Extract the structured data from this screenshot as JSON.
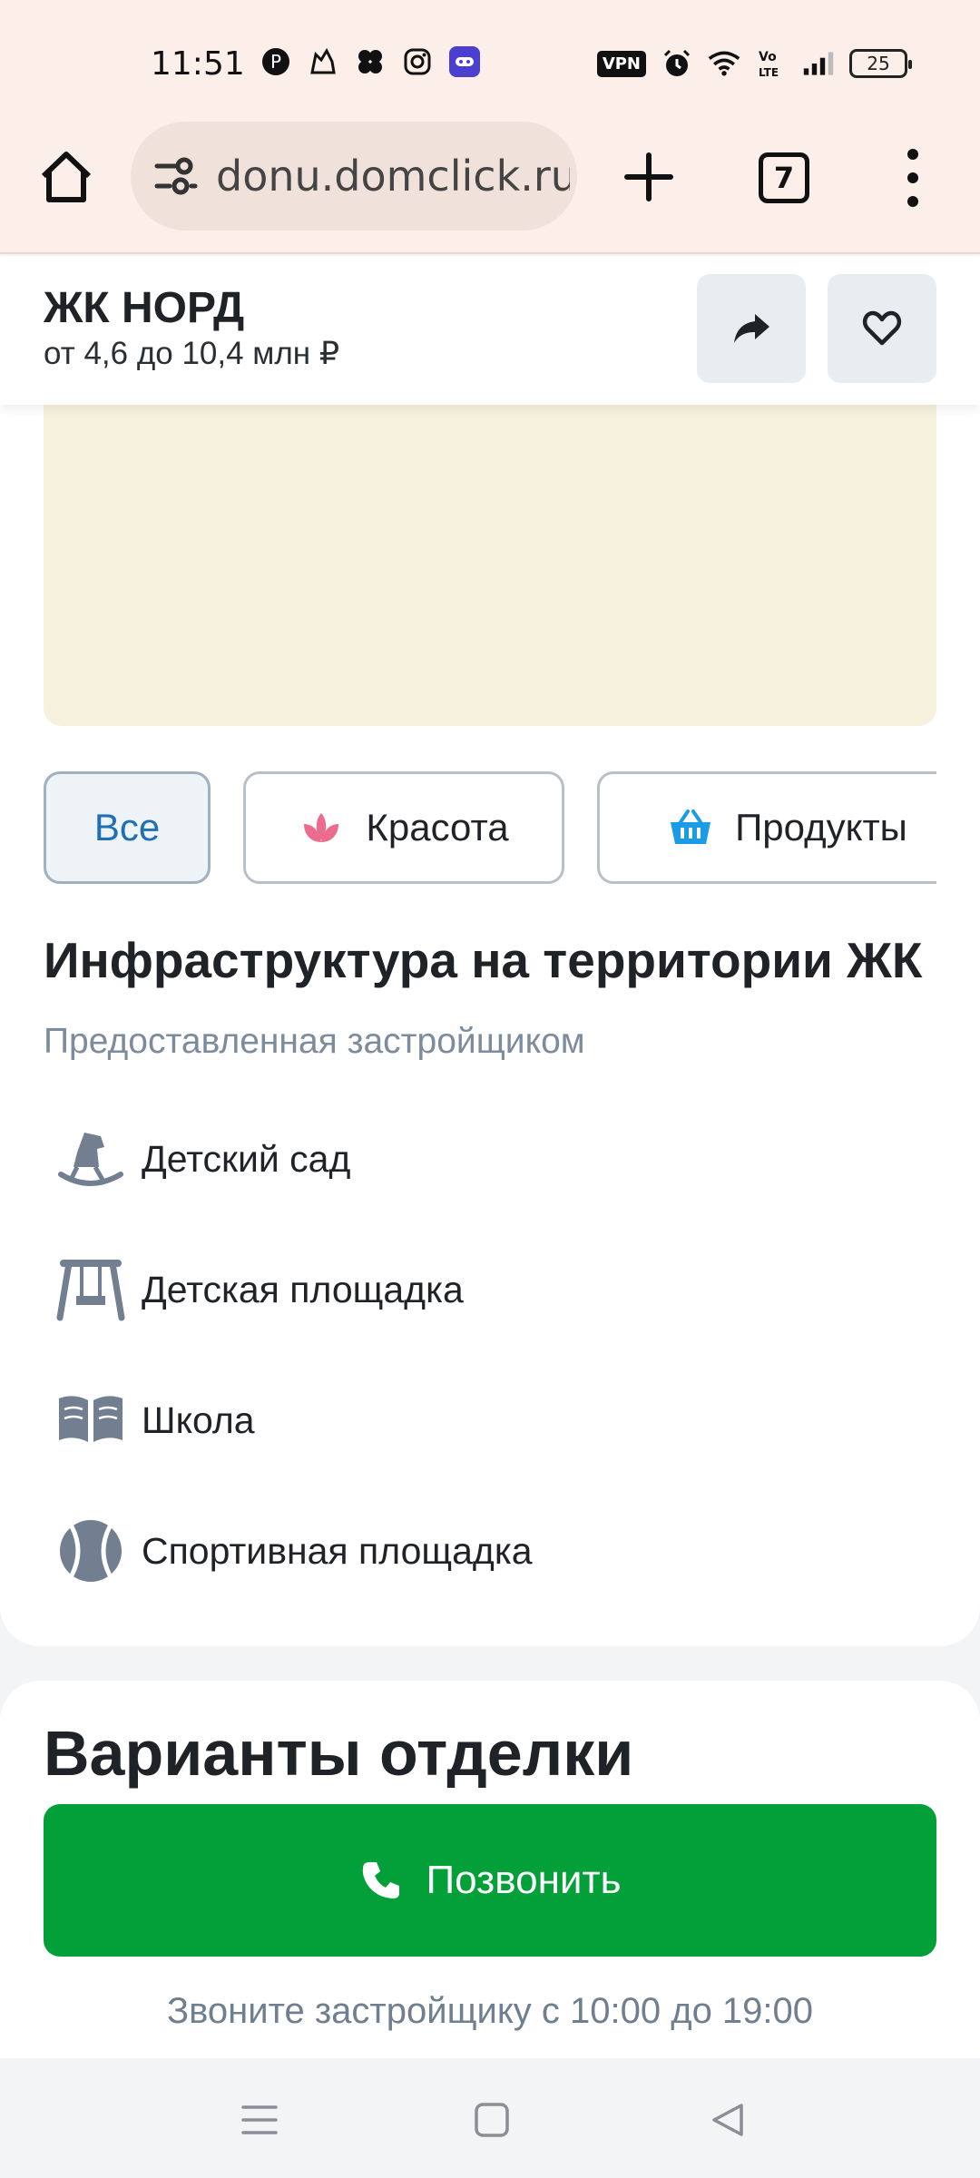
{
  "status_bar": {
    "time": "11:51",
    "left_icons": [
      "pinterest-icon",
      "cat-app-icon",
      "flower-app-icon",
      "instagram-icon",
      "game-app-icon"
    ],
    "vpn_label": "VPN",
    "right_icons": [
      "alarm-icon",
      "wifi-icon",
      "volte-icon",
      "signal-icon"
    ],
    "battery_level": "25"
  },
  "browser": {
    "url": "donu.domclick.ru",
    "tab_count": "7"
  },
  "header": {
    "title": "ЖК НОРД",
    "price": "от 4,6 до 10,4 млн ₽"
  },
  "chips": [
    {
      "label": "Все",
      "active": true
    },
    {
      "label": "Красота",
      "icon": "lotus-icon",
      "active": false
    },
    {
      "label": "Продукты",
      "icon": "basket-icon",
      "active": false
    }
  ],
  "infrastructure": {
    "title": "Инфраструктура на территории ЖК",
    "subtitle": "Предоставленная застройщиком",
    "items": [
      {
        "label": "Детский сад",
        "icon": "rocking-horse-icon"
      },
      {
        "label": "Детская площадка",
        "icon": "swing-icon"
      },
      {
        "label": "Школа",
        "icon": "book-icon"
      },
      {
        "label": "Спортивная площадка",
        "icon": "ball-icon"
      }
    ]
  },
  "finishing": {
    "title": "Варианты отделки",
    "call_button": "Позвонить",
    "call_note": "Звоните застройщику с 10:00 до 19:00"
  },
  "colors": {
    "accent_green": "#03a03a",
    "chip_active_text": "#1e6fb5",
    "muted_text": "#7c8c9c",
    "map_bg": "#f6f1dc"
  }
}
